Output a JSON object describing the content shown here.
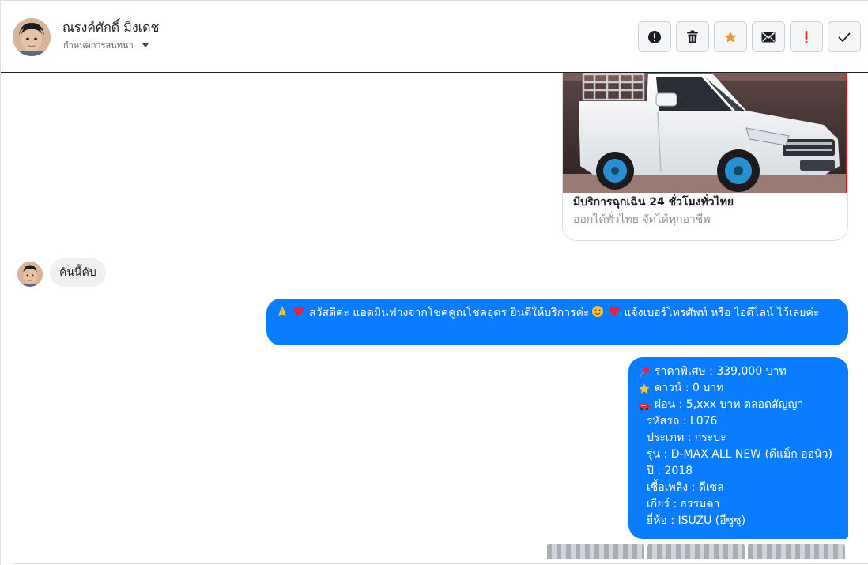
{
  "header": {
    "contact_name": "ณรงค์ศักดิ์ มิ่งเดช",
    "contact_sub": "กำหนดการสนทนา",
    "actions": [
      {
        "name": "report-icon",
        "label": "report"
      },
      {
        "name": "trash-icon",
        "label": "delete"
      },
      {
        "name": "star-icon",
        "label": "star"
      },
      {
        "name": "envelope-icon",
        "label": "mark unread"
      },
      {
        "name": "exclamation-icon",
        "label": "important"
      },
      {
        "name": "check-icon",
        "label": "done"
      }
    ],
    "colors": {
      "star": "#f7923a",
      "exclamation": "#e4302e"
    }
  },
  "attachment": {
    "title": "มีบริการฉุกเฉิน 24 ชั่วโมงทั่วไทย",
    "subtitle": "ออกได้ทั่วไทย จัดได้ทุกอาชีพ"
  },
  "messages": {
    "incoming_text": "คันนี้คับ",
    "greeting": "สวัสดีค่ะ แอดมินฟางจากโชคคูณโชคอุดร ยินดีให้บริการค่ะ",
    "greeting_tail": "แจ้งเบอร์โทรศัพท์ หรือ ไอดีไลน์  ไว้เลยค่ะ",
    "info_lines": [
      {
        "emoji": "pushpin-icon",
        "text": "ราคาพิเศษ : 339,000 บาท"
      },
      {
        "emoji": "star-icon",
        "text": "ดาวน์ : 0 บาท"
      },
      {
        "emoji": "car-icon",
        "text": "ผ่อน : 5,xxx บาท ตลอดสัญญา"
      },
      {
        "emoji": "",
        "text": "รหัสรถ : L076"
      },
      {
        "emoji": "",
        "text": "ประเภท : กระบะ"
      },
      {
        "emoji": "",
        "text": "รุ่น : D-MAX ALL NEW (ดีแม็ก ออนิว)"
      },
      {
        "emoji": "",
        "text": "ปี : 2018"
      },
      {
        "emoji": "",
        "text": "เชื้อเพลิง : ดีเซล"
      },
      {
        "emoji": "",
        "text": "เกียร์ : ธรรมดา"
      },
      {
        "emoji": "",
        "text": "ยี่ห้อ : ISUZU (อีซูซุ)"
      }
    ],
    "bubble_color": "#0a7cff"
  }
}
